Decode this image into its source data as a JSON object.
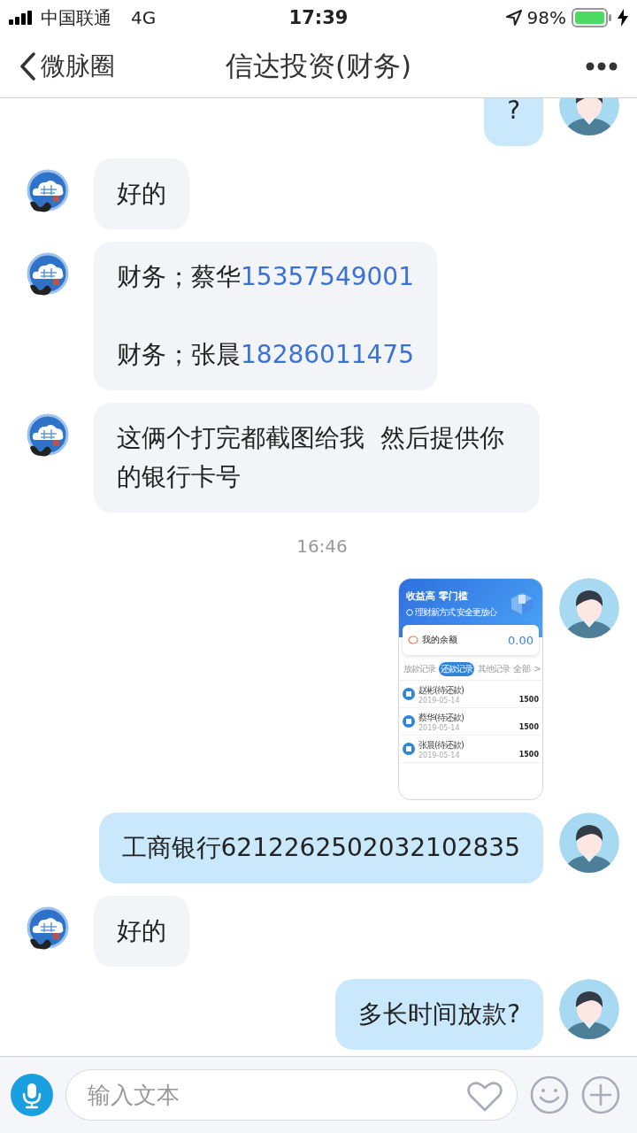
{
  "status_bar": {
    "carrier": "中国联通",
    "network": "4G",
    "time": "17:39",
    "battery_text": "98%"
  },
  "nav": {
    "back_label": "微脉圈",
    "title": "信达投资(财务)"
  },
  "messages": [
    {
      "kind": "sent-text",
      "paragraphs": [
        {
          "text": "?"
        }
      ]
    },
    {
      "kind": "received-text",
      "paragraphs": [
        {
          "text": "好的"
        }
      ]
    },
    {
      "kind": "received-text",
      "paragraphs": [
        {
          "text": "财务；蔡华",
          "link": "15357549001"
        },
        {
          "text": "财务；张晨",
          "link": "18286011475"
        }
      ]
    },
    {
      "kind": "received-text",
      "paragraphs": [
        {
          "text": "这俩个打完都截图给我  然后提供你的银行卡号"
        }
      ]
    },
    {
      "kind": "time",
      "text": "16:46"
    },
    {
      "kind": "sent-image",
      "screenshot": {
        "headline": "收益高 零门槛",
        "subline": "理财新方式 安全更放心",
        "balance_label": "我的余额",
        "balance": "0.00",
        "tabs": [
          {
            "label": "放款记录",
            "selected": false
          },
          {
            "label": "还款记录",
            "selected": true
          },
          {
            "label": "其他记录",
            "selected": false
          }
        ],
        "more": "全部 >",
        "records": [
          {
            "name": "赵彬(待还款)",
            "date": "2019-05-14",
            "amount": "1500"
          },
          {
            "name": "蔡华(待还款)",
            "date": "2019-05-14",
            "amount": "1500"
          },
          {
            "name": "张晨(待还款)",
            "date": "2019-05-14",
            "amount": "1500"
          }
        ]
      }
    },
    {
      "kind": "sent-text",
      "paragraphs": [
        {
          "text": "工商银行6212262502032102835"
        }
      ]
    },
    {
      "kind": "received-text",
      "paragraphs": [
        {
          "text": "好的"
        }
      ]
    },
    {
      "kind": "sent-text",
      "paragraphs": [
        {
          "text": "多长时间放款?"
        }
      ]
    }
  ],
  "input_bar": {
    "placeholder": "输入文本"
  }
}
